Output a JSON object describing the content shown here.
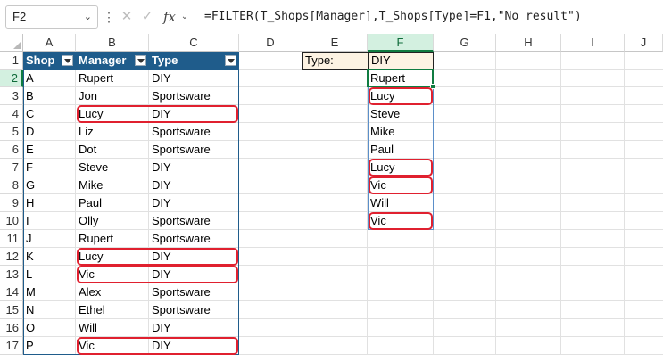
{
  "formula_bar": {
    "name_box": "F2",
    "more_icon": "⋮",
    "cancel_icon": "✕",
    "enter_icon": "✓",
    "fx_label": "fx",
    "fx_dropdown": "⌄",
    "formula": "=FILTER(T_Shops[Manager],T_Shops[Type]=F1,\"No result\")"
  },
  "columns": [
    "A",
    "B",
    "C",
    "D",
    "E",
    "F",
    "G",
    "H",
    "I",
    "J"
  ],
  "selected_column": "F",
  "selected_row": 2,
  "rows": [
    "1",
    "2",
    "3",
    "4",
    "5",
    "6",
    "7",
    "8",
    "9",
    "10",
    "11",
    "12",
    "13",
    "14",
    "15",
    "16",
    "17"
  ],
  "table": {
    "name": "T_Shops",
    "headers": [
      "Shop",
      "Manager",
      "Type"
    ],
    "records": [
      [
        "A",
        "Rupert",
        "DIY"
      ],
      [
        "B",
        "Jon",
        "Sportsware"
      ],
      [
        "C",
        "Lucy",
        "DIY"
      ],
      [
        "D",
        "Liz",
        "Sportsware"
      ],
      [
        "E",
        "Dot",
        "Sportsware"
      ],
      [
        "F",
        "Steve",
        "DIY"
      ],
      [
        "G",
        "Mike",
        "DIY"
      ],
      [
        "H",
        "Paul",
        "DIY"
      ],
      [
        "I",
        "Olly",
        "Sportsware"
      ],
      [
        "J",
        "Rupert",
        "Sportsware"
      ],
      [
        "K",
        "Lucy",
        "DIY"
      ],
      [
        "L",
        "Vic",
        "DIY"
      ],
      [
        "M",
        "Alex",
        "Sportsware"
      ],
      [
        "N",
        "Ethel",
        "Sportsware"
      ],
      [
        "O",
        "Will",
        "DIY"
      ],
      [
        "P",
        "Vic",
        "DIY"
      ]
    ]
  },
  "criteria": {
    "label": "Type:",
    "value": "DIY"
  },
  "result": [
    "Rupert",
    "Lucy",
    "Steve",
    "Mike",
    "Paul",
    "Lucy",
    "Vic",
    "Will",
    "Vic"
  ],
  "colors": {
    "table_header": "#1f5c8b",
    "criteria_fill": "#fdf3e3",
    "highlight_circle": "#e0202f",
    "selection": "#107c41",
    "header_selected_fill": "#d3f0e0"
  }
}
